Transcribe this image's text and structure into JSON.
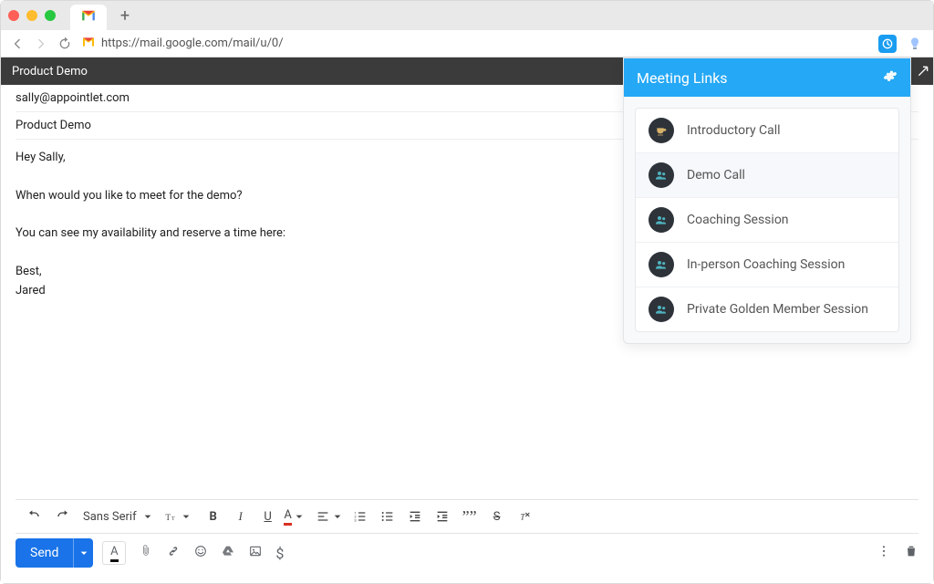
{
  "browser": {
    "url": "https://mail.google.com/mail/u/0/",
    "favicon_letter": "M"
  },
  "compose": {
    "window_title": "Product Demo",
    "to": "sally@appointlet.com",
    "subject": "Product Demo",
    "body": "Hey Sally,\n\nWhen would you like to meet for the demo?\n\nYou can see my availability and reserve a time here:\n\nBest,\nJared"
  },
  "format_toolbar": {
    "font_family": "Sans Serif"
  },
  "send_button": {
    "label": "Send"
  },
  "panel": {
    "title": "Meeting Links",
    "items": [
      {
        "label": "Introductory Call",
        "icon": "cup",
        "highlight": false
      },
      {
        "label": "Demo Call",
        "icon": "people",
        "highlight": true
      },
      {
        "label": "Coaching Session",
        "icon": "people",
        "highlight": false
      },
      {
        "label": "In-person Coaching Session",
        "icon": "people",
        "highlight": false
      },
      {
        "label": "Private Golden Member Session",
        "icon": "people",
        "highlight": false
      }
    ]
  }
}
